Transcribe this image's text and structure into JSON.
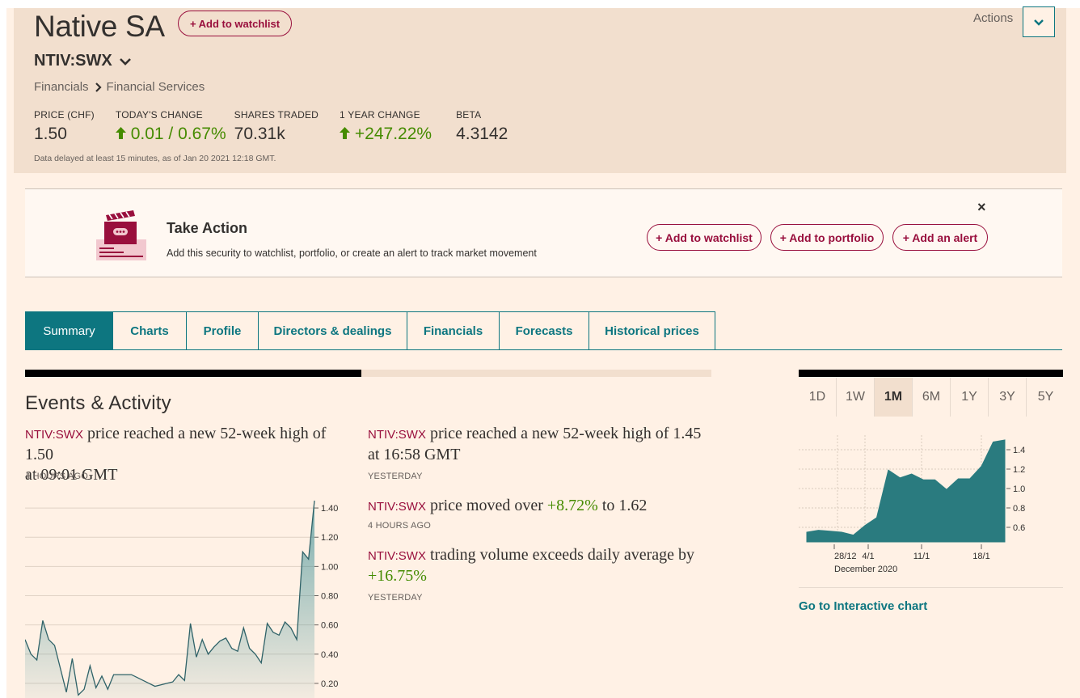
{
  "header": {
    "company_name": "Native SA",
    "watchlist_button": "+ Add to watchlist",
    "ticker": "NTIV:SWX",
    "breadcrumb": [
      "Financials",
      "Financial Services"
    ],
    "actions_label": "Actions",
    "stats": [
      {
        "label": "PRICE (CHF)",
        "value": "1.50",
        "trend": "none"
      },
      {
        "label": "TODAY'S CHANGE",
        "value": "0.01 / 0.67%",
        "trend": "up"
      },
      {
        "label": "SHARES TRADED",
        "value": "70.31k",
        "trend": "none"
      },
      {
        "label": "1 YEAR CHANGE",
        "value": "+247.22%",
        "trend": "up"
      },
      {
        "label": "BETA",
        "value": "4.3142",
        "trend": "none"
      }
    ],
    "delay_note": "Data delayed at least 15 minutes, as of Jan 20 2021 12:18 GMT."
  },
  "banner": {
    "title": "Take Action",
    "text": "Add this security to watchlist, portfolio, or create an alert to track market movement",
    "buttons": [
      "+ Add to watchlist",
      "+ Add to portfolio",
      "+ Add an alert"
    ],
    "close": "×"
  },
  "tabs": [
    "Summary",
    "Charts",
    "Profile",
    "Directors & dealings",
    "Financials",
    "Forecasts",
    "Historical prices"
  ],
  "active_tab": "Summary",
  "events": {
    "title": "Events & Activity",
    "items": [
      {
        "ticker": "NTIV:SWX",
        "line1": " price reached a new 52-week high of 1.50",
        "line2": "at 09:01 GMT",
        "highlight": "",
        "ago": "4 HOURS AGO"
      },
      {
        "ticker": "NTIV:SWX",
        "line1": " price reached a new 52-week high of 1.45",
        "line2": "at 16:58 GMT",
        "highlight": "",
        "ago": "YESTERDAY"
      },
      {
        "ticker": "NTIV:SWX",
        "line1": " price moved over ",
        "highlight": "+8.72%",
        "line2": " to 1.62",
        "ago": "4 HOURS AGO"
      },
      {
        "ticker": "NTIV:SWX",
        "line1": " trading volume exceeds daily average by",
        "highlight": "+16.75%",
        "line2": "",
        "ago": "YESTERDAY"
      }
    ]
  },
  "ranges": [
    "1D",
    "1W",
    "1M",
    "6M",
    "1Y",
    "3Y",
    "5Y"
  ],
  "active_range": "1M",
  "goto_link": "Go to Interactive chart",
  "colors": {
    "accent": "#0d7680",
    "claret": "#990f3d",
    "up": "#458b00",
    "background": "#fff1e5"
  },
  "chart_data": [
    {
      "type": "area",
      "title": "",
      "xlabel": "",
      "ylabel": "",
      "ylim": [
        0.1,
        1.5
      ],
      "yticks": [
        "1.40",
        "1.20",
        "1.00",
        "0.80",
        "0.60",
        "0.40",
        "0.20"
      ],
      "x": [
        0,
        1,
        2,
        3,
        4,
        5,
        6,
        7,
        8,
        9,
        10,
        11,
        12,
        13,
        14,
        15,
        16,
        17,
        18,
        19,
        20,
        21,
        22,
        23,
        24,
        25,
        26,
        27,
        28,
        29,
        30,
        31,
        32,
        33,
        34,
        35,
        36,
        37,
        38,
        39,
        40,
        41,
        42,
        43,
        44,
        45,
        46,
        47,
        48,
        49,
        50,
        51,
        52,
        53,
        54,
        55,
        56,
        57
      ],
      "values": [
        0.5,
        0.4,
        0.36,
        0.63,
        0.5,
        0.46,
        0.3,
        0.14,
        0.37,
        0.12,
        0.16,
        0.32,
        0.17,
        0.25,
        0.16,
        0.26,
        0.26,
        0.26,
        0.26,
        0.24,
        0.22,
        0.2,
        0.18,
        0.19,
        0.2,
        0.21,
        0.26,
        0.22,
        0.61,
        0.38,
        0.5,
        0.4,
        0.45,
        0.49,
        0.51,
        0.44,
        0.42,
        0.58,
        0.44,
        0.4,
        0.34,
        0.61,
        0.55,
        0.53,
        0.62,
        0.58,
        0.5,
        1.1,
        1.05,
        1.45
      ],
      "grid": true
    },
    {
      "type": "area",
      "title": "",
      "xlabel": "",
      "ylabel": "",
      "ylim": [
        0.45,
        1.55
      ],
      "yticks": [
        "1.4",
        "1.2",
        "1.0",
        "0.8",
        "0.6"
      ],
      "xticks": [
        "28/12",
        "4/1",
        "11/1",
        "18/1"
      ],
      "xsublabel": "December 2020",
      "values": [
        0.55,
        0.57,
        0.56,
        0.55,
        0.52,
        0.62,
        0.7,
        1.19,
        1.11,
        1.15,
        1.09,
        1.09,
        0.99,
        1.1,
        1.1,
        1.23,
        1.48,
        1.5
      ],
      "grid": true
    }
  ]
}
